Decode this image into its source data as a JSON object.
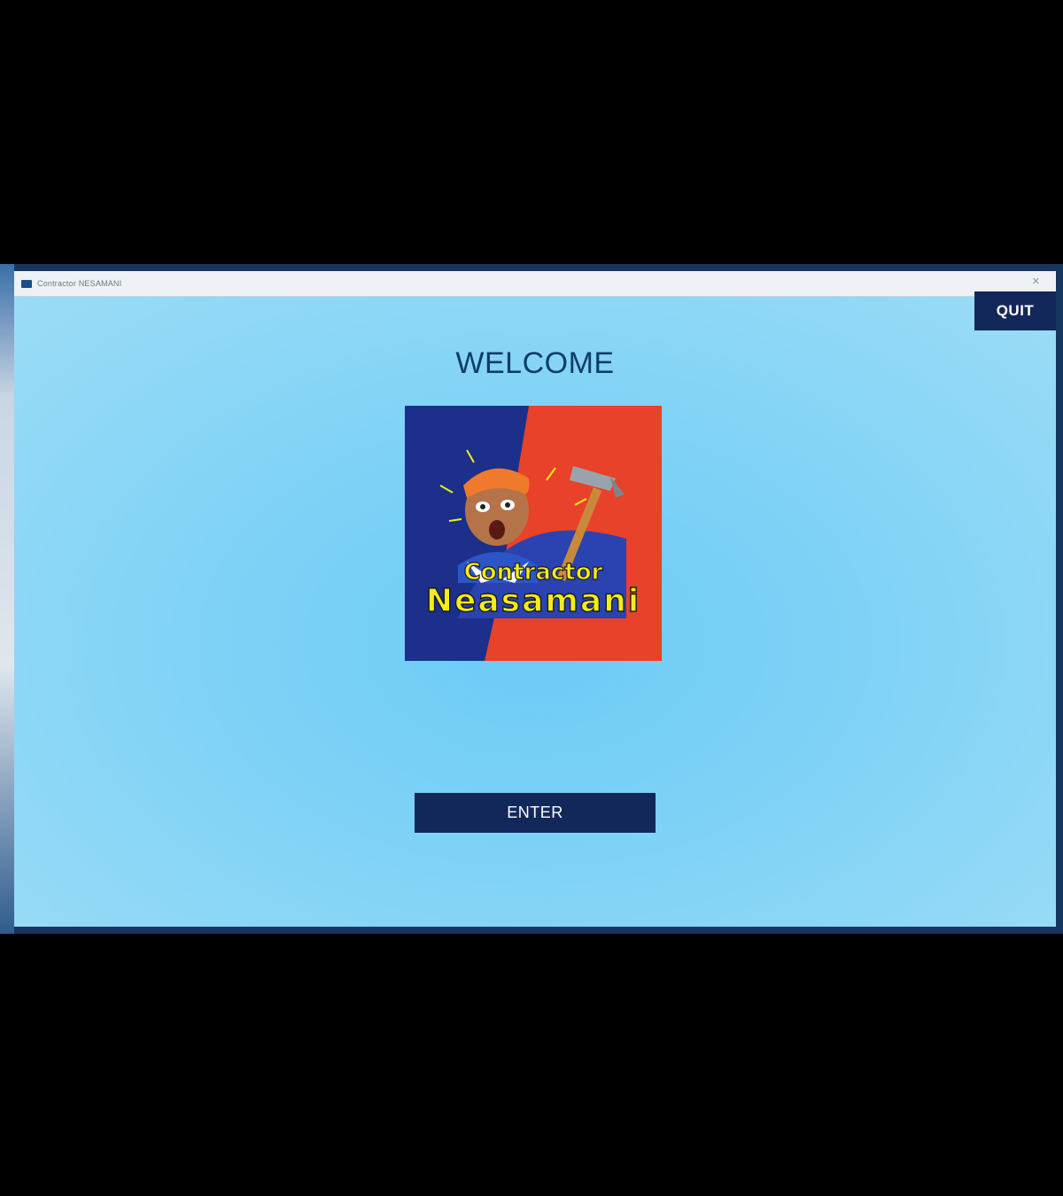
{
  "window": {
    "title": "Contractor NESAMANI"
  },
  "header": {
    "quit_label": "QUIT",
    "welcome_text": "WELCOME"
  },
  "logo": {
    "line1": "Contractor",
    "line2": "Neasamani",
    "colors": {
      "left": "#1c2f8a",
      "right": "#e8422a",
      "text": "#f5ec1a"
    }
  },
  "actions": {
    "enter_label": "ENTER"
  },
  "theme": {
    "background": "#7fd2f6",
    "button": "#13285a"
  }
}
